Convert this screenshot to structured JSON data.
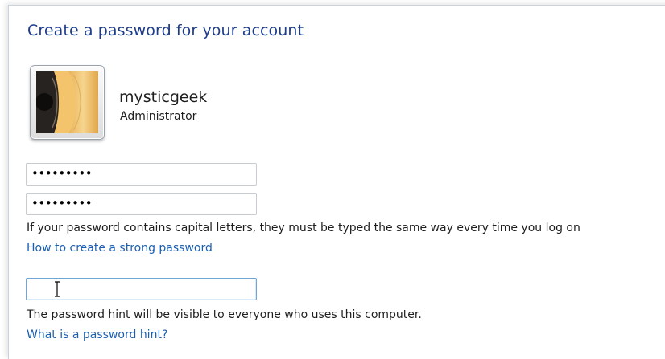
{
  "heading": "Create a password for your account",
  "account": {
    "username": "mysticgeek",
    "role": "Administrator",
    "avatar_icon": "guitar-avatar-icon"
  },
  "form": {
    "password_value": "•••••••••",
    "confirm_password_value": "•••••••••",
    "capital_letters_note": "If your password contains capital letters, they must be typed the same way every time you log on",
    "strong_password_link": "How to create a strong password",
    "hint_value": "",
    "hint_note": "The password hint will be visible to everyone who uses this computer.",
    "hint_help_link": "What is a password hint?"
  },
  "colors": {
    "heading": "#1e3c8c",
    "link": "#1b5fb0",
    "focus_border": "#6fa6d6"
  }
}
